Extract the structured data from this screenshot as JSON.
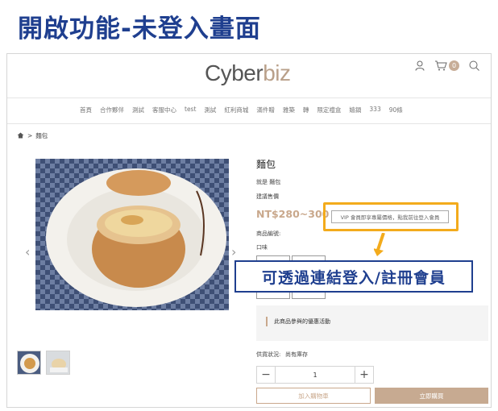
{
  "slide_title": "開啟功能-未登入畫面",
  "header": {
    "logo_part1": "Cyber",
    "logo_part2": "biz",
    "cart_count": "0"
  },
  "nav": {
    "items": [
      "首頁",
      "合作夥伴",
      "測試",
      "客服中心",
      "test",
      "測試",
      "紅利商城",
      "滿件贈",
      "雅築",
      "轉",
      "限定禮盒",
      "嬉鍋",
      "333",
      "90條"
    ]
  },
  "breadcrumb": {
    "separator": ">",
    "current": "麵包"
  },
  "product": {
    "title": "麵包",
    "subtitle": "就是 麵包",
    "price_label": "建議售價",
    "price": "NT$280~300",
    "vip_button": "VIP 會員即享專屬價格，點我前往登入會員",
    "sku_label": "商品編號:",
    "flavor_label": "口味",
    "promo_text": "此商品參與的優惠活動",
    "stock_label": "供貨狀況:",
    "stock_value": "尚有庫存",
    "quantity": "1",
    "qty_minus": "−",
    "qty_plus": "+",
    "add_to_cart": "加入購物車",
    "buy_now": "立即購買"
  },
  "callout": "可透過連結登入/註冊會員",
  "colors": {
    "title_blue": "#1f3f8f",
    "highlight_orange": "#f3ab1c",
    "brand_tan": "#c7aa91"
  }
}
